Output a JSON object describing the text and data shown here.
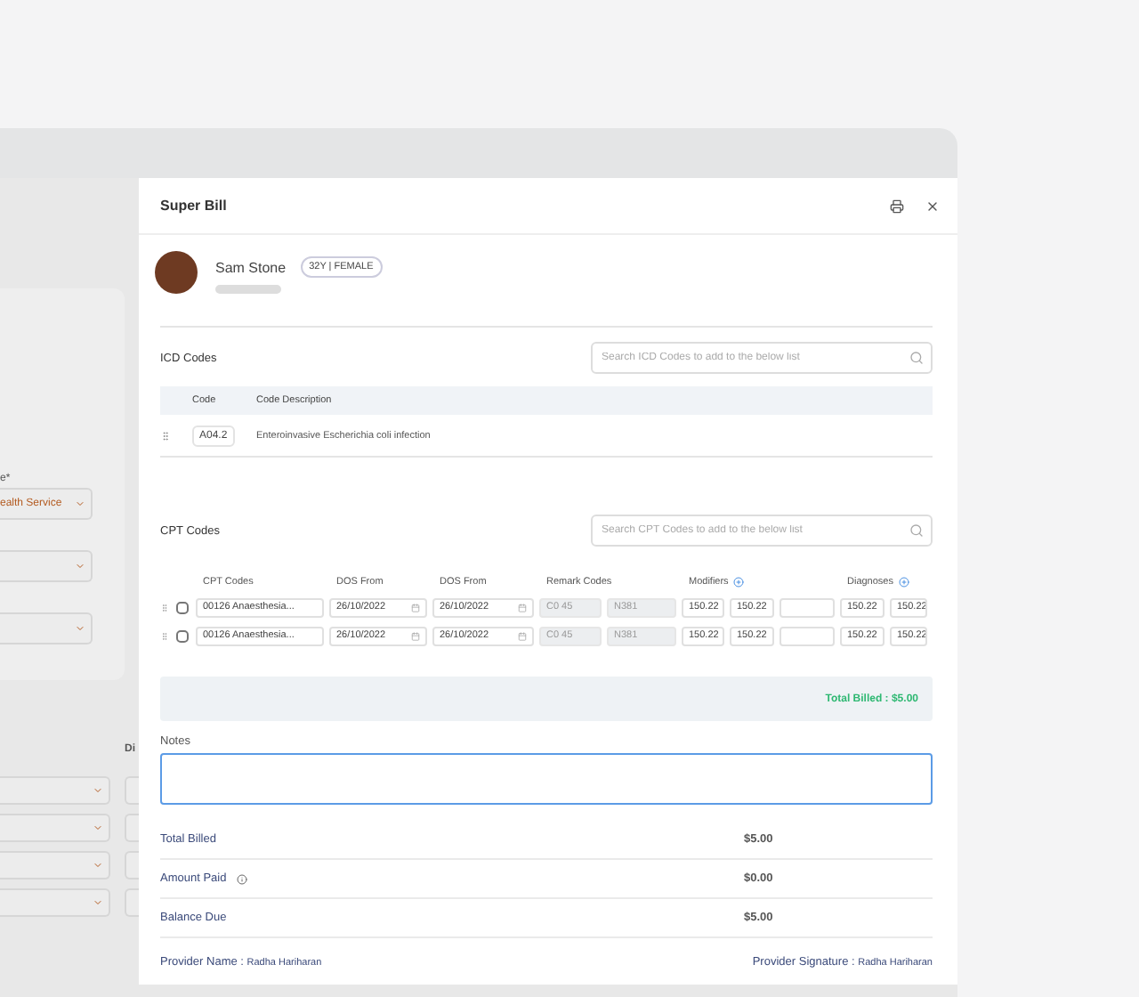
{
  "backdrop": {
    "field_label": "e*",
    "selects": [
      "ealth Service"
    ],
    "column_label": "Di"
  },
  "drawer": {
    "title": "Super Bill"
  },
  "patient": {
    "name": "Sam Stone",
    "badge": "32Y | FEMALE"
  },
  "icd": {
    "title": "ICD Codes",
    "search": {
      "placeholder": "Search ICD Codes to add to the below list"
    },
    "columns": [
      "Code",
      "Code Description"
    ],
    "rows": [
      {
        "code": "A04.2",
        "description": "Enteroinvasive Escherichia coli infection"
      }
    ]
  },
  "cpt": {
    "title": "CPT Codes",
    "search": {
      "placeholder": "Search CPT Codes to add to the below list"
    },
    "columns": [
      "CPT Codes",
      "DOS From",
      "DOS From",
      "Remark Codes",
      "Modifiers",
      "Diagnoses"
    ],
    "rows": [
      {
        "checked": false,
        "code": "00126  Anaesthesia...",
        "dos_from": "26/10/2022",
        "dos_to": "26/10/2022",
        "remarks": [
          "C0 45",
          "N381"
        ],
        "modifiers": [
          "150.22",
          "150.22"
        ],
        "diagnoses": [
          "150.22",
          "150.22"
        ]
      },
      {
        "checked": false,
        "code": "00126  Anaesthesia...",
        "dos_from": "26/10/2022",
        "dos_to": "26/10/2022",
        "remarks": [
          "C0 45",
          "N381"
        ],
        "modifiers": [
          "150.22",
          "150.22"
        ],
        "diagnoses": [
          "150.22",
          "150.22"
        ]
      }
    ],
    "total": "Total Billed : $5.00"
  },
  "notes": {
    "label": "Notes"
  },
  "summary": [
    {
      "label": "Total Billed",
      "amount": "$5.00",
      "info": false
    },
    {
      "label": "Amount Paid",
      "amount": "$0.00",
      "info": true
    },
    {
      "label": "Balance Due",
      "amount": "$5.00",
      "info": false
    }
  ],
  "provider": {
    "name_label": "Provider Name : ",
    "name": "Radha Hariharan",
    "signature_label": "Provider Signature : ",
    "signature": "Radha Hariharan"
  }
}
